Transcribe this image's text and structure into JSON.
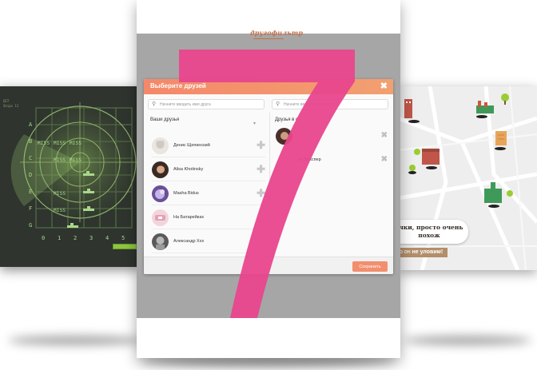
{
  "colors": {
    "accent": "#f4886a",
    "overlay": "#a6a6a6",
    "seven": "#e8468c",
    "radar_bg": "#2f342f",
    "radar_green": "#8ec63f"
  },
  "radar": {
    "top_lines": [
      "EET",
      "Ships 11"
    ],
    "rows": [
      "A",
      "B",
      "C",
      "D",
      "E",
      "F",
      "G"
    ],
    "cols": [
      "0",
      "1",
      "2",
      "3",
      "4",
      "5"
    ],
    "misses": [
      "MISS",
      "MISS",
      "MISS",
      "MISS",
      "MISS",
      "MISS",
      "MISS"
    ]
  },
  "app": {
    "logo": "другофильтр"
  },
  "modal": {
    "title": "Выберите друзей",
    "close_icon": "close-icon",
    "search_left_placeholder": "Начните вводить имя друга",
    "search_right_placeholder": "Начните вводить имя друга",
    "left_column_title": "Ваши друзья",
    "right_column_title": "Друзья в с",
    "friends": [
      {
        "name": "Денис Щепинский"
      },
      {
        "name": "Alisa Khotinsky"
      },
      {
        "name": "Masha Bidus"
      },
      {
        "name": "На Батарейках"
      },
      {
        "name": "Александр Xxx"
      }
    ],
    "selected": [
      {
        "name": ""
      },
      {
        "name": "на Векспер"
      }
    ],
    "save_label": "Сохранить"
  },
  "map": {
    "bubble_text_1": "ечки, просто очень",
    "bubble_text_2": "похож",
    "tag_prefix": "о он ",
    "tag_bold": "не уловим!"
  },
  "overlay_number": "7"
}
